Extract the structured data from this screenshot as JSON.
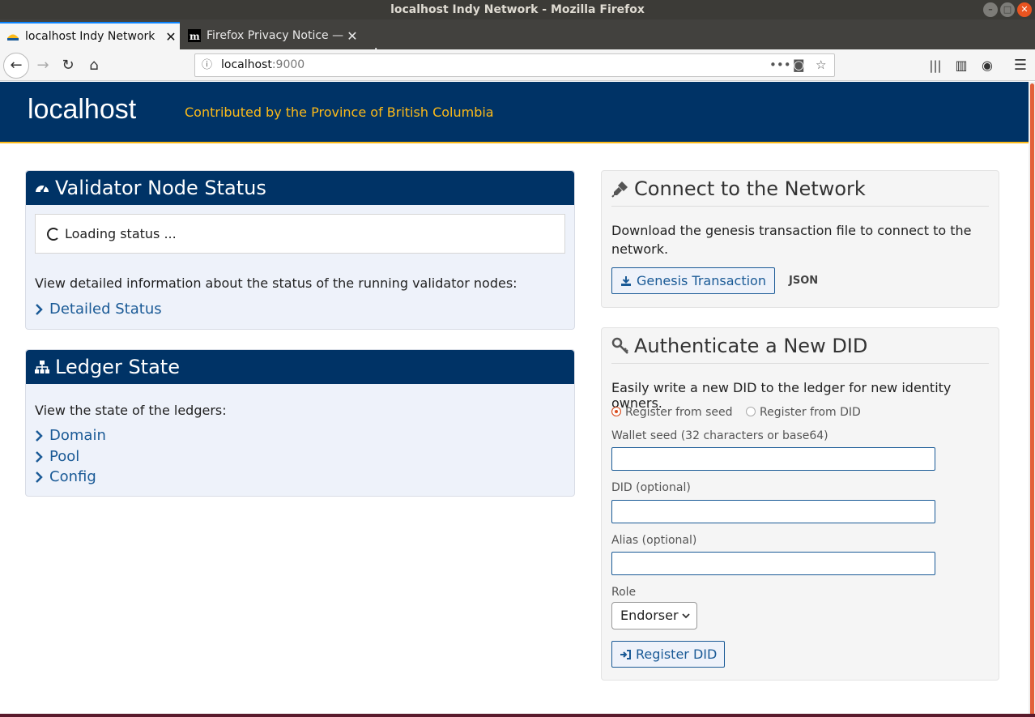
{
  "window": {
    "title": "localhost Indy Network - Mozilla Firefox"
  },
  "tabs": [
    {
      "label": "localhost Indy Network",
      "active": true
    },
    {
      "label": "Firefox Privacy Notice —",
      "active": false
    }
  ],
  "urlbar": {
    "host": "localhost",
    "port": ":9000"
  },
  "header": {
    "brand": "localhost",
    "tagline": "Contributed by the Province of British Columbia"
  },
  "validator": {
    "title": "Validator Node Status",
    "loading": "Loading status ...",
    "description": "View detailed information about the status of the running validator nodes:",
    "link": "Detailed Status"
  },
  "ledger": {
    "title": "Ledger State",
    "description": "View the state of the ledgers:",
    "links": [
      "Domain",
      "Pool",
      "Config"
    ]
  },
  "connect": {
    "title": "Connect to the Network",
    "description": "Download the genesis transaction file to connect to the network.",
    "button": "Genesis Transaction",
    "json_link": "JSON"
  },
  "authenticate": {
    "title": "Authenticate a New DID",
    "description": "Easily write a new DID to the ledger for new identity owners.",
    "radio_seed": "Register from seed",
    "radio_did": "Register from DID",
    "seed_label": "Wallet seed (32 characters or base64)",
    "did_label": "DID (optional)",
    "alias_label": "Alias (optional)",
    "role_label": "Role",
    "role_value": "Endorser",
    "submit": "Register DID"
  },
  "colors": {
    "header_bg": "#003366",
    "accent_gold": "#fcba19",
    "link_blue": "#1a5a96",
    "radio_selected": "#d94d1f"
  }
}
